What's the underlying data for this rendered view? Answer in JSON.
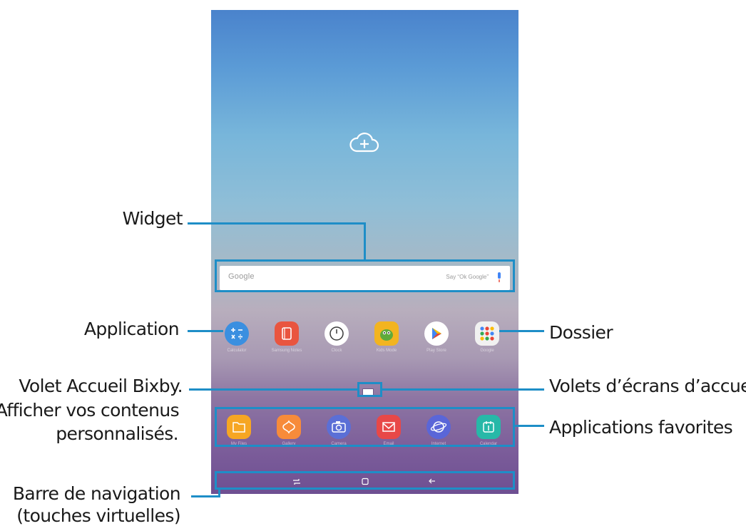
{
  "callouts": {
    "widget": "Widget",
    "application": "Application",
    "bixby_line1": "Volet Accueil Bixby.",
    "bixby_line2": "Afficher vos contenus",
    "bixby_line3": "personnalisés.",
    "nav_line1": "Barre de navigation",
    "nav_line2": "(touches virtuelles)",
    "folder": "Dossier",
    "home_panels": "Volets d’écrans d’accueil",
    "favorites": "Applications favorites"
  },
  "search_widget": {
    "logo_text": "Google",
    "hint_text": "Say “Ok Google”"
  },
  "home_apps": [
    {
      "name": "Calculator",
      "icon": "calculator-icon",
      "color": "#3b8fe0"
    },
    {
      "name": "Samsung Notes",
      "icon": "notes-icon",
      "color": "#e9553f"
    },
    {
      "name": "Clock",
      "icon": "clock-icon",
      "color": "#ffffff"
    },
    {
      "name": "Kids Mode",
      "icon": "kids-mode-icon",
      "color": "#f2b420"
    },
    {
      "name": "Play Store",
      "icon": "play-store-icon",
      "color": "#ffffff"
    },
    {
      "name": "Google",
      "icon": "google-folder-icon",
      "color": "#f1f1f1"
    }
  ],
  "favorite_apps": [
    {
      "name": "My Files",
      "icon": "my-files-icon",
      "color": "#f6a623"
    },
    {
      "name": "Gallery",
      "icon": "gallery-icon",
      "color": "#f78b3a"
    },
    {
      "name": "Camera",
      "icon": "camera-icon",
      "color": "#5b6fd6"
    },
    {
      "name": "Email",
      "icon": "email-icon",
      "color": "#e84848"
    },
    {
      "name": "Internet",
      "icon": "internet-icon",
      "color": "#5a66d8"
    },
    {
      "name": "Calendar",
      "icon": "calendar-icon",
      "color": "#27b8a8"
    }
  ],
  "nav_buttons": [
    "recents-icon",
    "home-icon",
    "back-icon"
  ],
  "colors": {
    "callout_line": "#1e8ec7",
    "wallpaper_top": "#4a83cc",
    "wallpaper_bottom": "#6e4f92"
  }
}
